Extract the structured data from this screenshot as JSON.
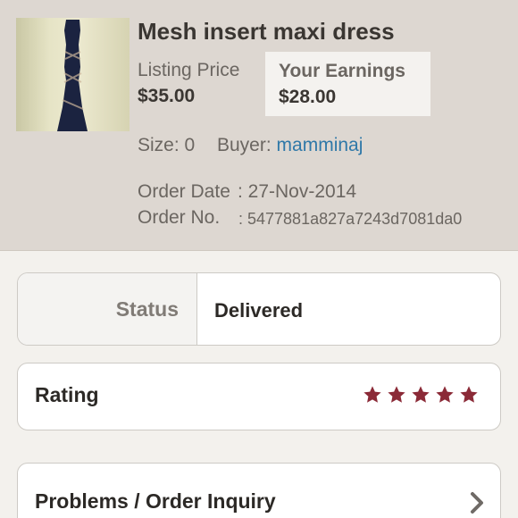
{
  "item": {
    "title": "Mesh insert maxi dress",
    "listing_price_label": "Listing Price",
    "listing_price": "$35.00",
    "earnings_label": "Your Earnings",
    "earnings": "$28.00",
    "size_label": "Size:",
    "size_value": "0",
    "buyer_label": "Buyer:",
    "buyer_name": "mamminaj",
    "order_date_label": "Order Date",
    "order_date": ": 27-Nov-2014",
    "order_no_label": "Order No.",
    "order_no": ": 5477881a827a7243d7081da0"
  },
  "status": {
    "label": "Status",
    "value": "Delivered"
  },
  "rating": {
    "label": "Rating",
    "stars": 5,
    "max_stars": 5,
    "star_color": "#8b2a37"
  },
  "problems": {
    "label": "Problems / Order Inquiry",
    "icon": "chevron-right-icon"
  },
  "colors": {
    "link": "#2f78a8",
    "header_bg": "#ddd7d1",
    "earn_box_bg": "#f4f2ef"
  }
}
